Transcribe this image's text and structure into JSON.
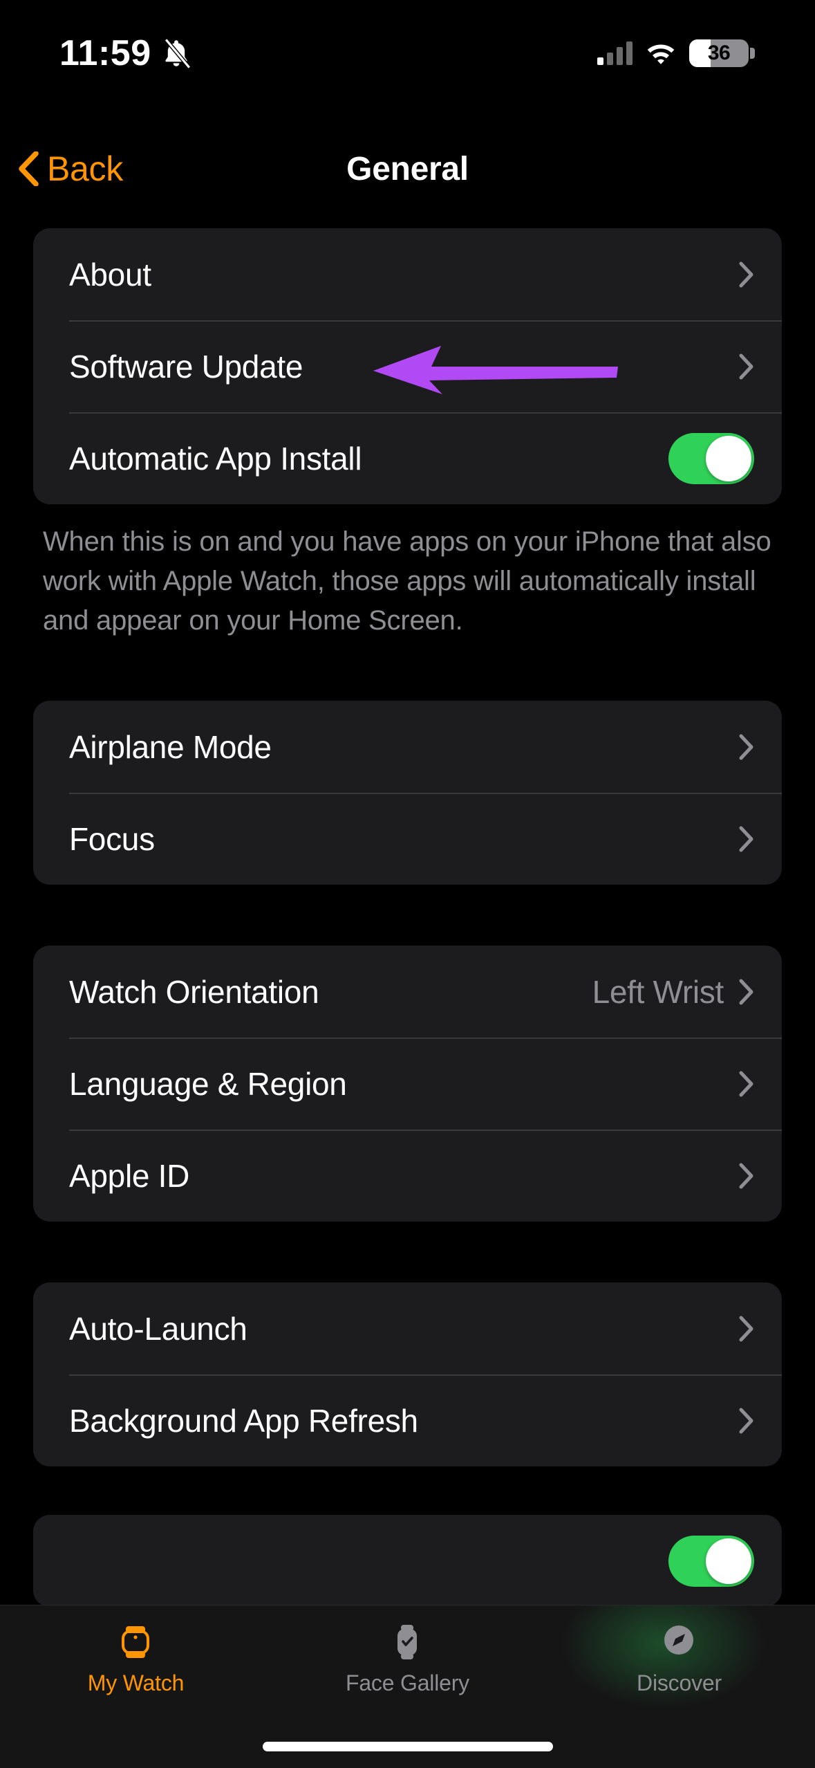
{
  "status_bar": {
    "time": "11:59",
    "silent_icon": "bell-slash-icon",
    "cellular_icon": "cellular-signal-icon",
    "wifi_icon": "wifi-icon",
    "battery_percent": "36",
    "battery_level": 36
  },
  "nav": {
    "back_label": "Back",
    "back_icon": "chevron-left-icon",
    "title": "General"
  },
  "groups": [
    {
      "rows": [
        {
          "label": "About",
          "type": "disclosure",
          "value": ""
        },
        {
          "label": "Software Update",
          "type": "disclosure",
          "value": ""
        },
        {
          "label": "Automatic App Install",
          "type": "toggle",
          "toggle_on": true
        }
      ],
      "footnote": "When this is on and you have apps on your iPhone that also work with Apple Watch, those apps will automatically install and appear on your Home Screen."
    },
    {
      "rows": [
        {
          "label": "Airplane Mode",
          "type": "disclosure",
          "value": ""
        },
        {
          "label": "Focus",
          "type": "disclosure",
          "value": ""
        }
      ]
    },
    {
      "rows": [
        {
          "label": "Watch Orientation",
          "type": "disclosure",
          "value": "Left Wrist"
        },
        {
          "label": "Language & Region",
          "type": "disclosure",
          "value": ""
        },
        {
          "label": "Apple ID",
          "type": "disclosure",
          "value": ""
        }
      ]
    },
    {
      "rows": [
        {
          "label": "Auto-Launch",
          "type": "disclosure",
          "value": ""
        },
        {
          "label": "Background App Refresh",
          "type": "disclosure",
          "value": ""
        }
      ]
    },
    {
      "rows": [
        {
          "label": "",
          "type": "toggle",
          "toggle_on": true
        }
      ]
    }
  ],
  "annotation": {
    "shape": "left-pointing-arrow",
    "color": "#B14AF5",
    "points_at": "Software Update"
  },
  "tabbar": {
    "tabs": [
      {
        "label": "My Watch",
        "icon": "watch-icon",
        "active": true
      },
      {
        "label": "Face Gallery",
        "icon": "watch-face-icon",
        "active": false
      },
      {
        "label": "Discover",
        "icon": "compass-icon",
        "active": false
      }
    ]
  },
  "colors": {
    "accent": "#FF9500",
    "toggle_on": "#30D158",
    "card_bg": "#1C1C1E",
    "page_bg": "#000000",
    "secondary_text": "#8E8E93",
    "annotation": "#B14AF5"
  }
}
